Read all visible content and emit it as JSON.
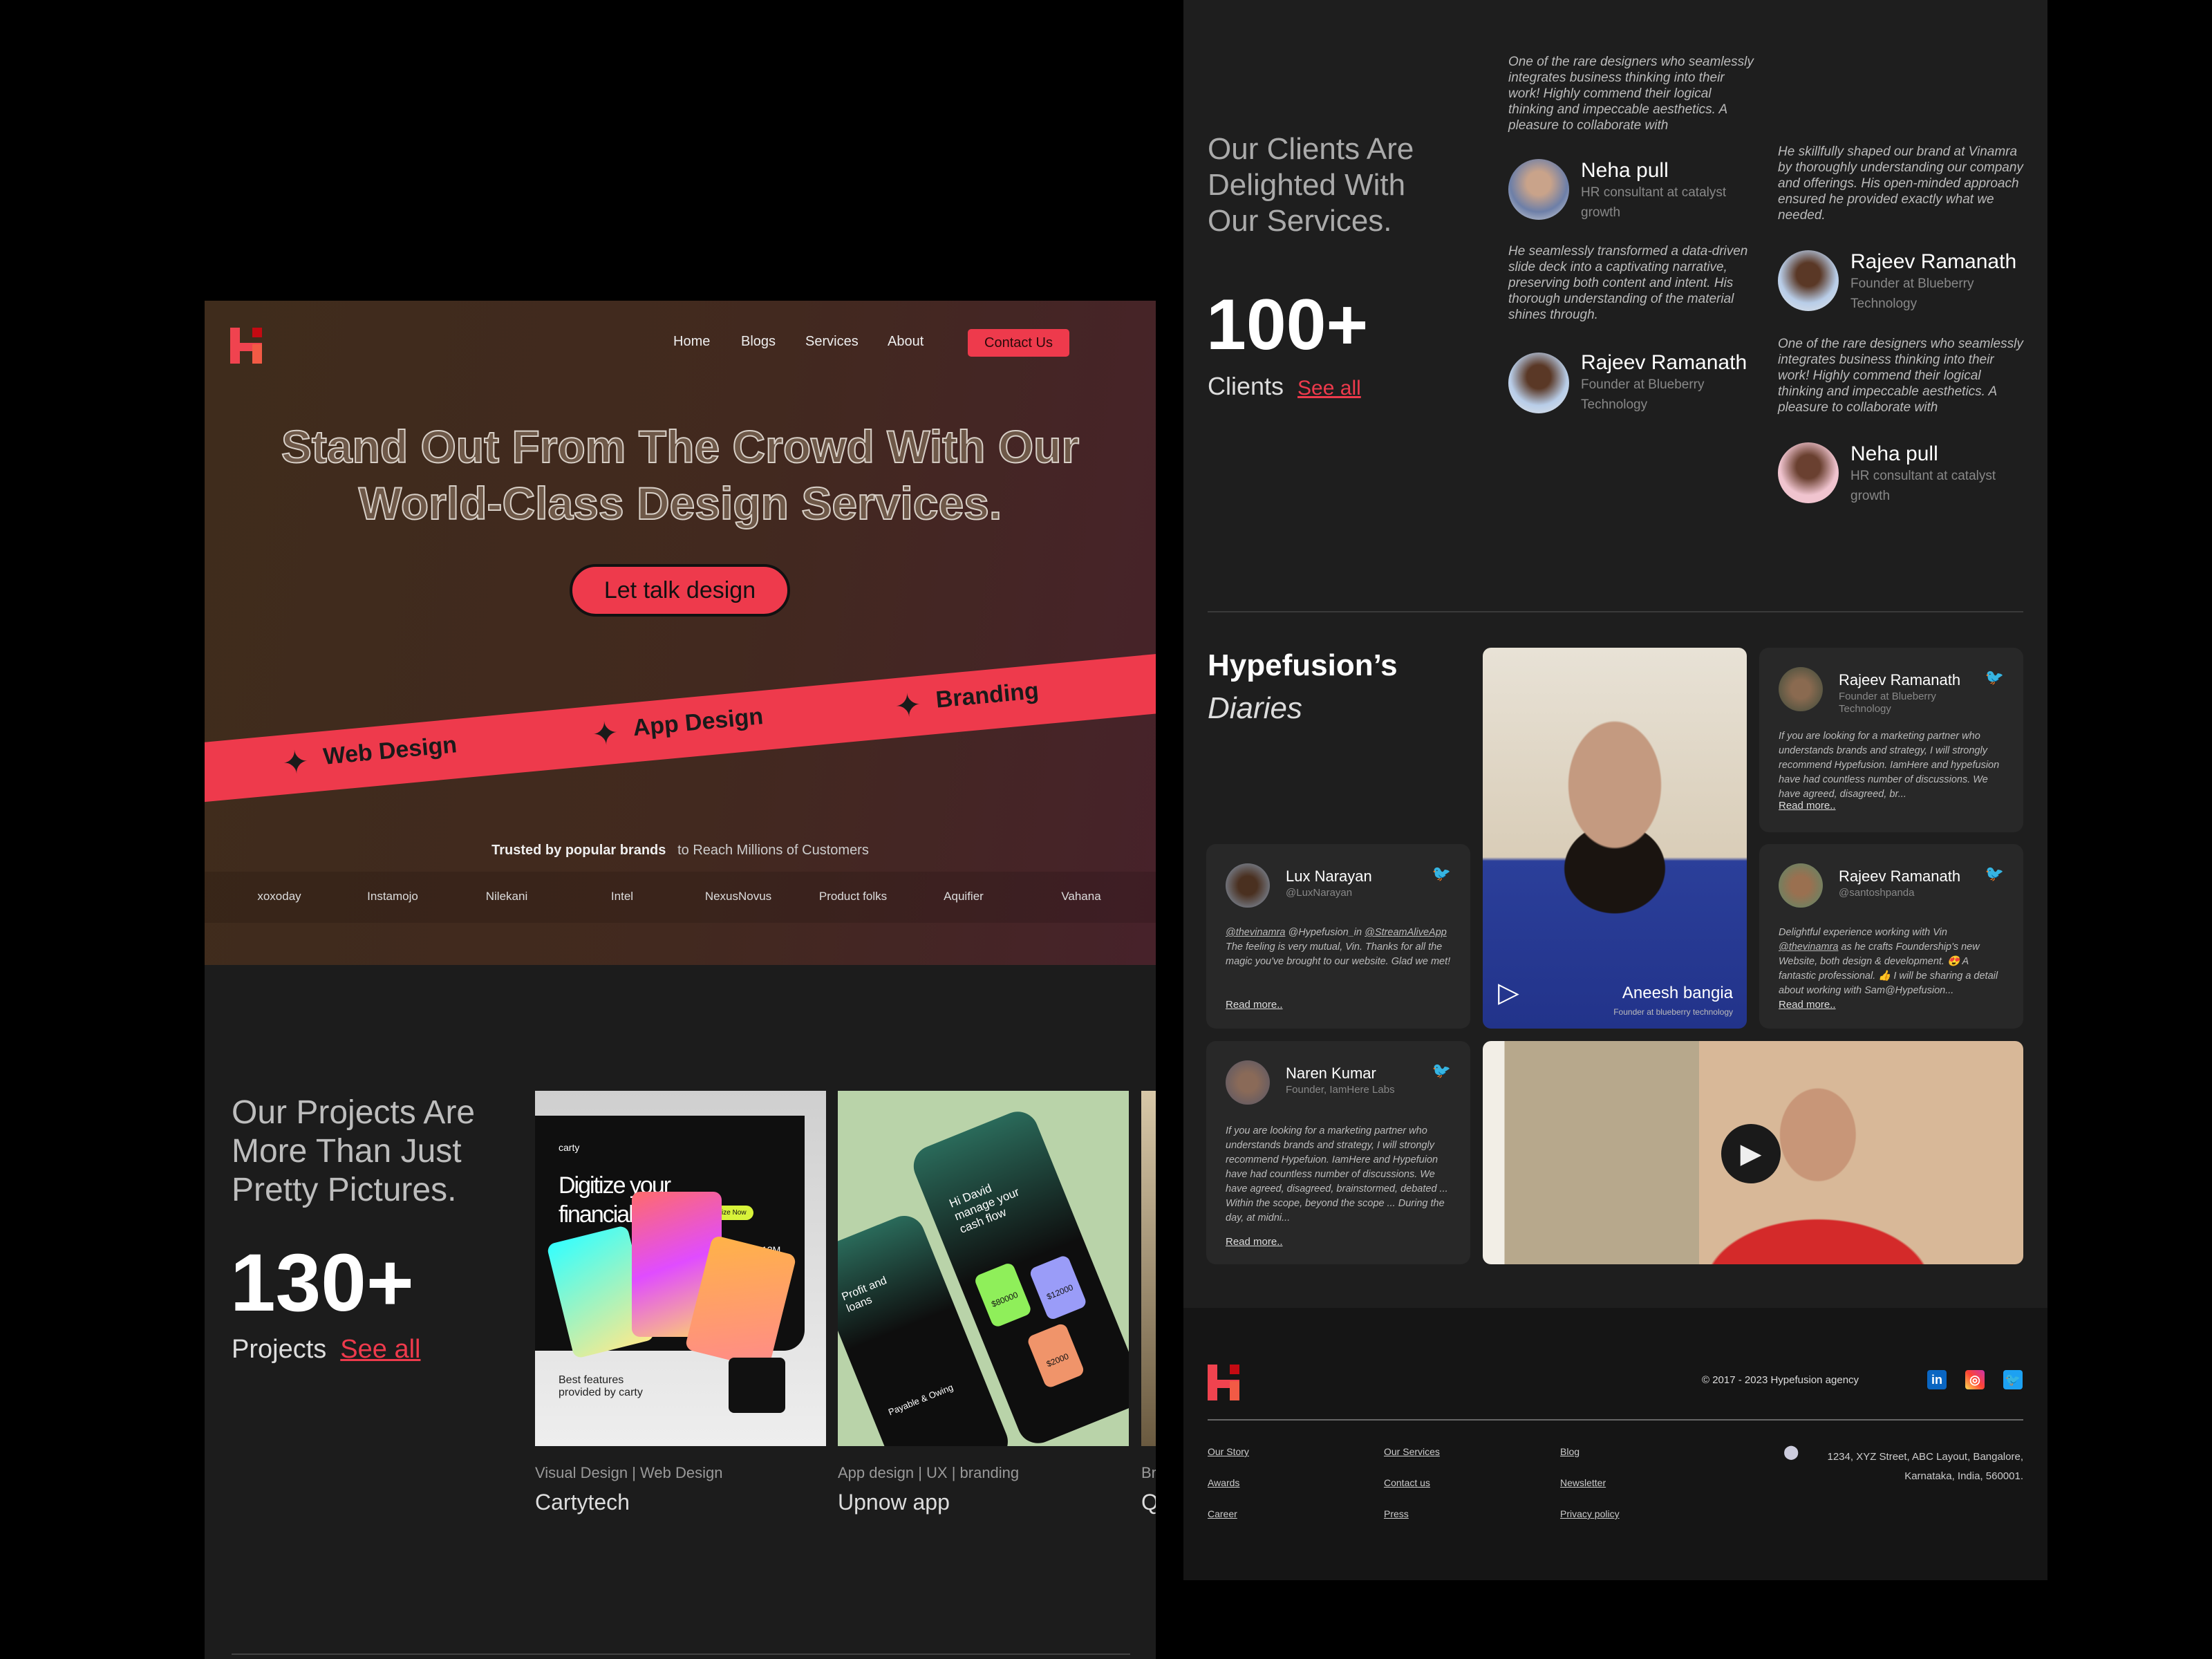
{
  "colors": {
    "accent": "#ee3a4c",
    "hero_bg": "#3f2c1c",
    "panel_bg": "#1e1e1e",
    "twitter": "#1da1f2"
  },
  "nav": {
    "items": [
      "Home",
      "Blogs",
      "Services",
      "About"
    ],
    "contact": "Contact Us"
  },
  "hero": {
    "headline_1": "Stand Out From The Crowd With Our",
    "headline_2": "World-Class Design Services.",
    "cta": "Let talk design",
    "band": [
      "Web Design",
      "App Design",
      "Branding"
    ],
    "trusted_bold": "Trusted by popular brands",
    "trusted_rest": "to Reach Millions of Customers",
    "brands": [
      "xoxoday",
      "Instamojo",
      "Nilekani",
      "Intel",
      "NexusNovus",
      "Product folks",
      "Aquifier",
      "Vahana"
    ]
  },
  "projects": {
    "title": [
      "Our Projects Are",
      "More Than Just",
      "Pretty Pictures."
    ],
    "count": "130+",
    "label": "Projects",
    "see_all": "See all",
    "cards": [
      {
        "tags": "Visual Design | Web Design",
        "name": "Cartytech",
        "mock": {
          "brand": "carty",
          "headline_1": "Digitize your",
          "headline_2": "financial",
          "button": "Digitize Now",
          "stat": "12M",
          "features": "Best features provided by carty"
        }
      },
      {
        "tags": "App design | UX | branding",
        "name": "Upnow app",
        "mock": {
          "greeting": "Hi David manage your cash flow",
          "section": "Profit and loans",
          "inflow": "$80000",
          "outflow": "$12000",
          "net": "$2000",
          "payable": "Payable & Owing"
        }
      },
      {
        "tags": "Br",
        "name": "Q"
      }
    ]
  },
  "clients": {
    "title": [
      "Our Clients Are",
      "Delighted With",
      "Our Services."
    ],
    "count": "100+",
    "label": "Clients",
    "see_all": "See all",
    "testimonials": [
      {
        "quote": "One of the rare designers who seamlessly integrates business thinking into their work! Highly commend their logical thinking and impeccable aesthetics. A pleasure to collaborate with",
        "name": "Neha pull",
        "role": "HR consultant at catalyst growth"
      },
      {
        "quote": "He seamlessly transformed a data-driven slide deck into a captivating narrative, preserving both content and intent. His thorough understanding of the material shines through.",
        "name": "Rajeev Ramanath",
        "role": "Founder at Blueberry Technology"
      },
      {
        "quote": "He skillfully shaped our brand at Vinamra by thoroughly understanding our company and offerings. His open-minded approach ensured he provided exactly what we needed.",
        "name": "Rajeev Ramanath",
        "role": "Founder at Blueberry Technology"
      },
      {
        "quote": "One of the rare designers who seamlessly integrates business thinking into their work! Highly commend their logical thinking and impeccable aesthetics. A pleasure to collaborate with",
        "name": "Neha pull",
        "role": "HR consultant at catalyst growth"
      }
    ]
  },
  "diaries": {
    "title": "Hypefusion’s",
    "subtitle": "Diaries",
    "read_more": "Read more..",
    "video1": {
      "name": "Aneesh bangia",
      "role": "Founder at blueberry technology"
    },
    "cards": [
      {
        "name": "Rajeev Ramanath",
        "role": "Founder at Blueberry Technology",
        "text": "If you are looking for a marketing partner who understands brands and strategy, I will strongly recommend Hypefusion. IamHere and hypefusion have had countless number of discussions. We have agreed, disagreed, br..."
      },
      {
        "name": "Lux Narayan",
        "role": "@LuxNarayan",
        "mention1": "@thevinamra",
        "mention2": "@Hypefusion_in",
        "mention3": "@StreamAliveApp",
        "text": "The feeling is very mutual, Vin. Thanks for all the magic you've brought to our website. Glad we met!"
      },
      {
        "name": "Rajeev Ramanath",
        "role": "@santoshpanda",
        "pre": "Delightful experience working with Vin",
        "mention": "@thevinamra",
        "text": "as he crafts Foundership's new Website, both design & development. 😍 A fantastic professional. 👍 I will be sharing a detail about working with Sam@Hypefusion..."
      },
      {
        "name": "Naren Kumar",
        "role": "Founder, IamHere Labs",
        "text": "If you are looking for a marketing partner who understands brands and strategy, I will strongly recommend Hypefuion. IamHere and Hypefuion  have had countless number of discussions. We have agreed, disagreed, brainstormed, debated ... Within the scope, beyond the scope ... During the day, at midni..."
      }
    ]
  },
  "footer": {
    "copyright": "© 2017 - 2023 Hypefusion agency",
    "social": [
      "linkedin-icon",
      "instagram-icon",
      "twitter-icon"
    ],
    "links": [
      [
        "Our Story",
        "Awards",
        "Career"
      ],
      [
        "Our Services",
        "Contact us",
        "Press"
      ],
      [
        "Blog",
        "Newsletter",
        "Privacy policy"
      ]
    ],
    "address_1": "1234, XYZ Street, ABC Layout, Bangalore,",
    "address_2": "Karnataka, India, 560001."
  }
}
